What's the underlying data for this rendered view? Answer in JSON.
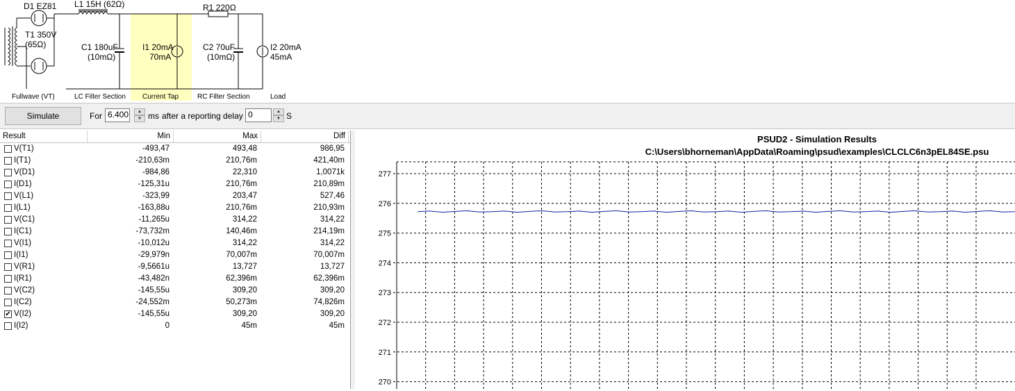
{
  "schematic": {
    "d1": "D1 EZ81",
    "t1_a": "T1 350V",
    "t1_b": "(65Ω)",
    "l1": "L1 15H (62Ω)",
    "c1_a": "C1 180uF",
    "c1_b": "(10mΩ)",
    "i1_a": "I1 20mA",
    "i1_b": "70mA",
    "r1": "R1 220Ω",
    "c2_a": "C2 70uF",
    "c2_b": "(10mΩ)",
    "i2_a": "I2 20mA",
    "i2_b": "45mA",
    "sections": [
      "Fullwave (VT)",
      "LC Filter Section",
      "Current Tap",
      "RC Filter Section",
      "Load"
    ],
    "highlight_color": "#ffffc0"
  },
  "toolbar": {
    "simulate": "Simulate",
    "for": "For",
    "duration": "6.400",
    "ms": "ms",
    "after": "after a reporting delay of",
    "delay": "0",
    "s": "S"
  },
  "table": {
    "headers": [
      "Result",
      "Min",
      "Max",
      "Diff"
    ],
    "rows": [
      {
        "name": "V(T1)",
        "min": "-493,47",
        "max": "493,48",
        "diff": "986,95",
        "checked": false
      },
      {
        "name": "I(T1)",
        "min": "-210,63m",
        "max": "210,76m",
        "diff": "421,40m",
        "checked": false
      },
      {
        "name": "V(D1)",
        "min": "-984,86",
        "max": "22,310",
        "diff": "1,0071k",
        "checked": false
      },
      {
        "name": "I(D1)",
        "min": "-125,31u",
        "max": "210,76m",
        "diff": "210,89m",
        "checked": false
      },
      {
        "name": "V(L1)",
        "min": "-323,99",
        "max": "203,47",
        "diff": "527,46",
        "checked": false
      },
      {
        "name": "I(L1)",
        "min": "-163,88u",
        "max": "210,76m",
        "diff": "210,93m",
        "checked": false
      },
      {
        "name": "V(C1)",
        "min": "-11,265u",
        "max": "314,22",
        "diff": "314,22",
        "checked": false
      },
      {
        "name": "I(C1)",
        "min": "-73,732m",
        "max": "140,46m",
        "diff": "214,19m",
        "checked": false
      },
      {
        "name": "V(I1)",
        "min": "-10,012u",
        "max": "314,22",
        "diff": "314,22",
        "checked": false
      },
      {
        "name": "I(I1)",
        "min": "-29,979n",
        "max": "70,007m",
        "diff": "70,007m",
        "checked": false
      },
      {
        "name": "V(R1)",
        "min": "-9,5661u",
        "max": "13,727",
        "diff": "13,727",
        "checked": false
      },
      {
        "name": "I(R1)",
        "min": "-43,482n",
        "max": "62,396m",
        "diff": "62,396m",
        "checked": false
      },
      {
        "name": "V(C2)",
        "min": "-145,55u",
        "max": "309,20",
        "diff": "309,20",
        "checked": false
      },
      {
        "name": "I(C2)",
        "min": "-24,552m",
        "max": "50,273m",
        "diff": "74,826m",
        "checked": false
      },
      {
        "name": "V(I2)",
        "min": "-145,55u",
        "max": "309,20",
        "diff": "309,20",
        "checked": true
      },
      {
        "name": "I(I2)",
        "min": "0",
        "max": "45m",
        "diff": "45m",
        "checked": false
      }
    ]
  },
  "chart_data": {
    "type": "line",
    "title": "PSUD2 - Simulation Results",
    "subtitle": "C:\\Users\\bhorneman\\AppData\\Roaming\\psud\\examples\\CLCLC6n3pEL84SE.psu",
    "yticks": [
      277,
      276,
      275,
      274,
      273,
      272,
      271,
      270
    ],
    "ylim": [
      270,
      277
    ],
    "grid": true,
    "series": [
      {
        "color": "#1020a0",
        "values": [
          275.72,
          275.74,
          275.7,
          275.73,
          275.75,
          275.71,
          275.72,
          275.74,
          275.7,
          275.73,
          275.75,
          275.71,
          275.72,
          275.74,
          275.7,
          275.73,
          275.75,
          275.71,
          275.72,
          275.74,
          275.7,
          275.73,
          275.75,
          275.71,
          275.72,
          275.74,
          275.7,
          275.73,
          275.75,
          275.71,
          275.72,
          275.74,
          275.7,
          275.73,
          275.75,
          275.71,
          275.72,
          275.74,
          275.7,
          275.73,
          275.75,
          275.71,
          275.72,
          275.74,
          275.7,
          275.73,
          275.75,
          275.71,
          275.72
        ]
      }
    ]
  }
}
